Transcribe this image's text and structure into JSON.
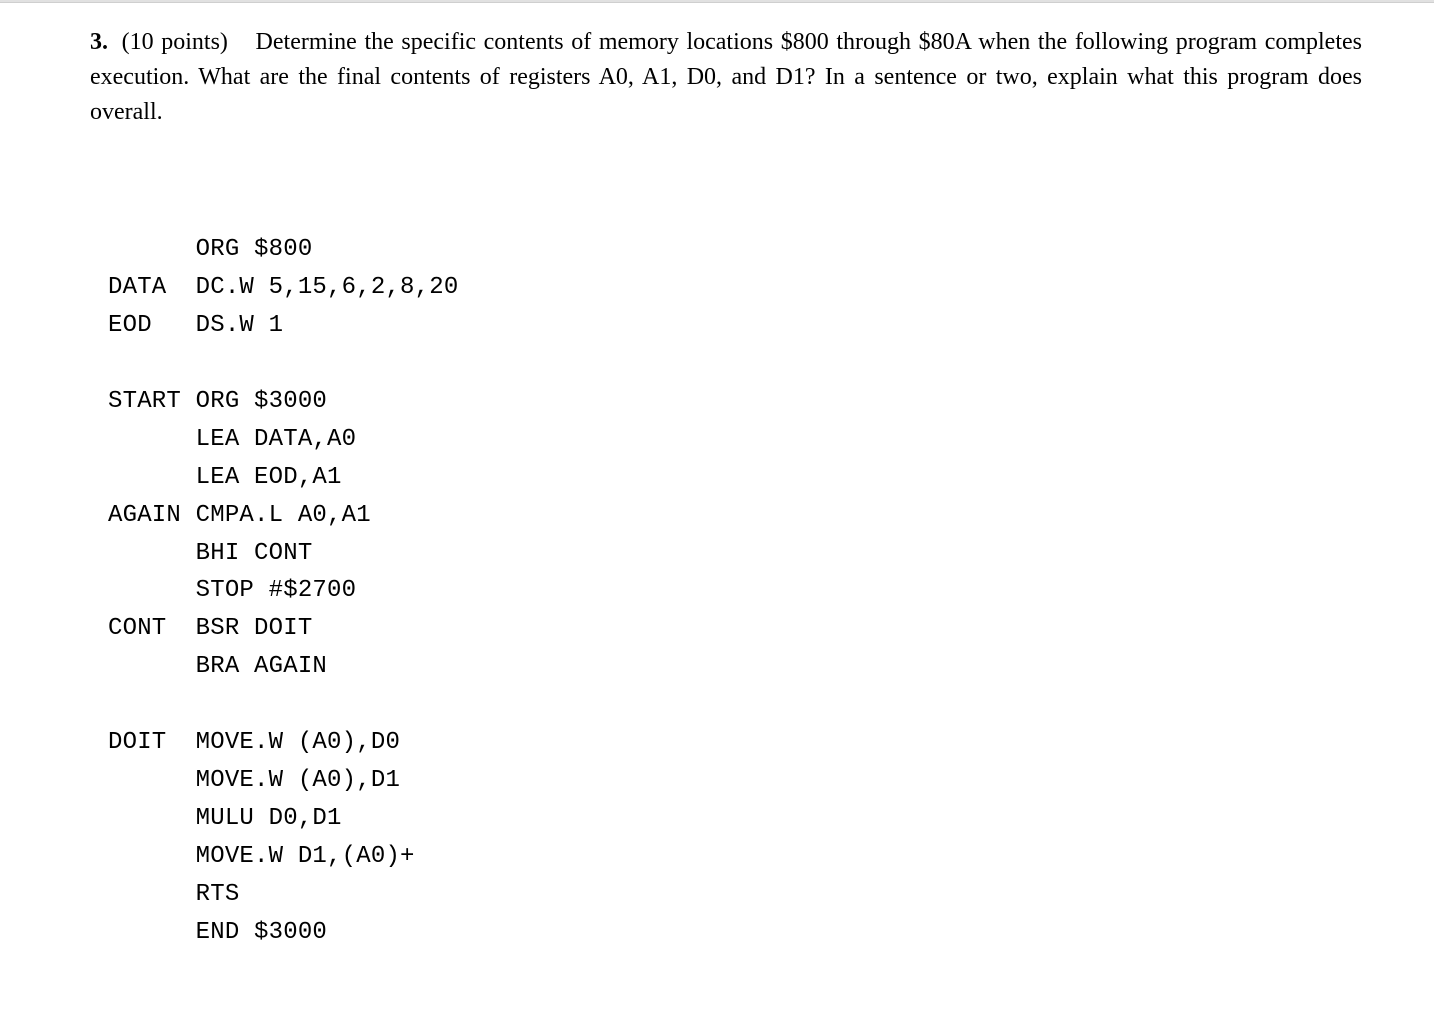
{
  "question": {
    "number": "3.",
    "points": "(10 points)",
    "prompt": "Determine the specific contents of memory locations $800 through $80A when the following program completes execution. What are the final contents of registers A0, A1, D0, and D1? In a sentence or two, explain what this program does overall."
  },
  "code": {
    "lines": [
      "      ORG $800",
      "DATA  DC.W 5,15,6,2,8,20",
      "EOD   DS.W 1",
      "",
      "START ORG $3000",
      "      LEA DATA,A0",
      "      LEA EOD,A1",
      "AGAIN CMPA.L A0,A1",
      "      BHI CONT",
      "      STOP #$2700",
      "CONT  BSR DOIT",
      "      BRA AGAIN",
      "",
      "DOIT  MOVE.W (A0),D0",
      "      MOVE.W (A0),D1",
      "      MULU D0,D1",
      "      MOVE.W D1,(A0)+",
      "      RTS",
      "      END $3000"
    ]
  }
}
